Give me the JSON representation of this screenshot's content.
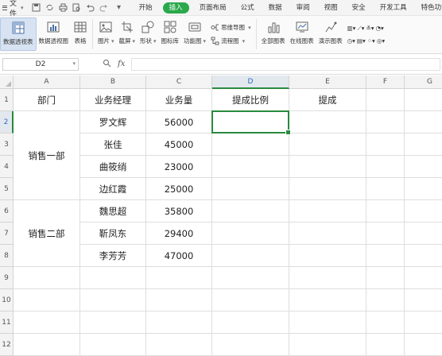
{
  "menubar": {
    "file_label": "文件",
    "tabs": [
      {
        "label": "开始"
      },
      {
        "label": "插入",
        "active": true
      },
      {
        "label": "页面布局"
      },
      {
        "label": "公式"
      },
      {
        "label": "数据"
      },
      {
        "label": "审阅"
      },
      {
        "label": "视图"
      },
      {
        "label": "安全"
      },
      {
        "label": "开发工具"
      },
      {
        "label": "特色功能"
      }
    ],
    "active_color": "#2aa94c"
  },
  "ribbon": {
    "pivot_table": "数据透视表",
    "pivot_chart": "数据透视图",
    "table": "表格",
    "picture": "图片",
    "screenshot": "截屏",
    "shape": "形状",
    "icon_lib": "图标库",
    "func_chart": "功能图",
    "mindmap": "思维导图",
    "flowchart": "流程图",
    "all_charts": "全部图表",
    "online_charts": "在线图表",
    "demo_charts": "演示图表"
  },
  "formula_bar": {
    "name_box": "D2",
    "fx_label": "fx",
    "formula": ""
  },
  "sheet": {
    "columns": [
      "A",
      "B",
      "C",
      "D",
      "E",
      "F",
      "G"
    ],
    "rows": [
      "1",
      "2",
      "3",
      "4",
      "5",
      "6",
      "7",
      "8",
      "9",
      "10",
      "11",
      "12"
    ],
    "active_cell": "D2",
    "header": [
      "部门",
      "业务经理",
      "业务量",
      "提成比例",
      "提成"
    ],
    "groups": [
      {
        "dept": "销售一部",
        "rows": [
          {
            "manager": "罗文辉",
            "amount": "56000"
          },
          {
            "manager": "张佳",
            "amount": "45000"
          },
          {
            "manager": "曲筱绡",
            "amount": "23000"
          },
          {
            "manager": "边红霞",
            "amount": "25000"
          }
        ]
      },
      {
        "dept": "销售二部",
        "rows": [
          {
            "manager": "魏思超",
            "amount": "35800"
          },
          {
            "manager": "靳凤东",
            "amount": "29400"
          },
          {
            "manager": "李芳芳",
            "amount": "47000"
          }
        ]
      }
    ],
    "selection_color": "#2a8a3e"
  }
}
